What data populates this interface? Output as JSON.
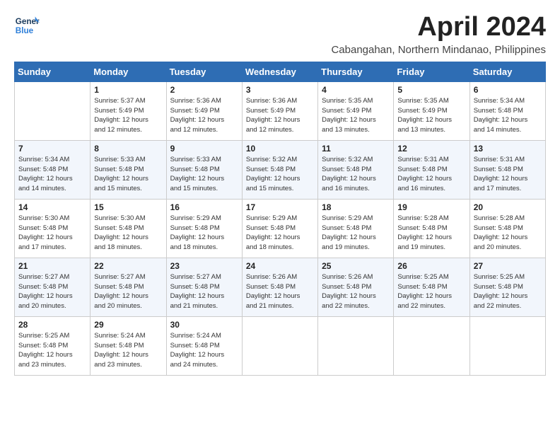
{
  "logo": {
    "line1": "General",
    "line2": "Blue"
  },
  "title": "April 2024",
  "subtitle": "Cabangahan, Northern Mindanao, Philippines",
  "days_of_week": [
    "Sunday",
    "Monday",
    "Tuesday",
    "Wednesday",
    "Thursday",
    "Friday",
    "Saturday"
  ],
  "weeks": [
    [
      {
        "day": "",
        "info": ""
      },
      {
        "day": "1",
        "info": "Sunrise: 5:37 AM\nSunset: 5:49 PM\nDaylight: 12 hours\nand 12 minutes."
      },
      {
        "day": "2",
        "info": "Sunrise: 5:36 AM\nSunset: 5:49 PM\nDaylight: 12 hours\nand 12 minutes."
      },
      {
        "day": "3",
        "info": "Sunrise: 5:36 AM\nSunset: 5:49 PM\nDaylight: 12 hours\nand 12 minutes."
      },
      {
        "day": "4",
        "info": "Sunrise: 5:35 AM\nSunset: 5:49 PM\nDaylight: 12 hours\nand 13 minutes."
      },
      {
        "day": "5",
        "info": "Sunrise: 5:35 AM\nSunset: 5:49 PM\nDaylight: 12 hours\nand 13 minutes."
      },
      {
        "day": "6",
        "info": "Sunrise: 5:34 AM\nSunset: 5:48 PM\nDaylight: 12 hours\nand 14 minutes."
      }
    ],
    [
      {
        "day": "7",
        "info": "Sunrise: 5:34 AM\nSunset: 5:48 PM\nDaylight: 12 hours\nand 14 minutes."
      },
      {
        "day": "8",
        "info": "Sunrise: 5:33 AM\nSunset: 5:48 PM\nDaylight: 12 hours\nand 15 minutes."
      },
      {
        "day": "9",
        "info": "Sunrise: 5:33 AM\nSunset: 5:48 PM\nDaylight: 12 hours\nand 15 minutes."
      },
      {
        "day": "10",
        "info": "Sunrise: 5:32 AM\nSunset: 5:48 PM\nDaylight: 12 hours\nand 15 minutes."
      },
      {
        "day": "11",
        "info": "Sunrise: 5:32 AM\nSunset: 5:48 PM\nDaylight: 12 hours\nand 16 minutes."
      },
      {
        "day": "12",
        "info": "Sunrise: 5:31 AM\nSunset: 5:48 PM\nDaylight: 12 hours\nand 16 minutes."
      },
      {
        "day": "13",
        "info": "Sunrise: 5:31 AM\nSunset: 5:48 PM\nDaylight: 12 hours\nand 17 minutes."
      }
    ],
    [
      {
        "day": "14",
        "info": "Sunrise: 5:30 AM\nSunset: 5:48 PM\nDaylight: 12 hours\nand 17 minutes."
      },
      {
        "day": "15",
        "info": "Sunrise: 5:30 AM\nSunset: 5:48 PM\nDaylight: 12 hours\nand 18 minutes."
      },
      {
        "day": "16",
        "info": "Sunrise: 5:29 AM\nSunset: 5:48 PM\nDaylight: 12 hours\nand 18 minutes."
      },
      {
        "day": "17",
        "info": "Sunrise: 5:29 AM\nSunset: 5:48 PM\nDaylight: 12 hours\nand 18 minutes."
      },
      {
        "day": "18",
        "info": "Sunrise: 5:29 AM\nSunset: 5:48 PM\nDaylight: 12 hours\nand 19 minutes."
      },
      {
        "day": "19",
        "info": "Sunrise: 5:28 AM\nSunset: 5:48 PM\nDaylight: 12 hours\nand 19 minutes."
      },
      {
        "day": "20",
        "info": "Sunrise: 5:28 AM\nSunset: 5:48 PM\nDaylight: 12 hours\nand 20 minutes."
      }
    ],
    [
      {
        "day": "21",
        "info": "Sunrise: 5:27 AM\nSunset: 5:48 PM\nDaylight: 12 hours\nand 20 minutes."
      },
      {
        "day": "22",
        "info": "Sunrise: 5:27 AM\nSunset: 5:48 PM\nDaylight: 12 hours\nand 20 minutes."
      },
      {
        "day": "23",
        "info": "Sunrise: 5:27 AM\nSunset: 5:48 PM\nDaylight: 12 hours\nand 21 minutes."
      },
      {
        "day": "24",
        "info": "Sunrise: 5:26 AM\nSunset: 5:48 PM\nDaylight: 12 hours\nand 21 minutes."
      },
      {
        "day": "25",
        "info": "Sunrise: 5:26 AM\nSunset: 5:48 PM\nDaylight: 12 hours\nand 22 minutes."
      },
      {
        "day": "26",
        "info": "Sunrise: 5:25 AM\nSunset: 5:48 PM\nDaylight: 12 hours\nand 22 minutes."
      },
      {
        "day": "27",
        "info": "Sunrise: 5:25 AM\nSunset: 5:48 PM\nDaylight: 12 hours\nand 22 minutes."
      }
    ],
    [
      {
        "day": "28",
        "info": "Sunrise: 5:25 AM\nSunset: 5:48 PM\nDaylight: 12 hours\nand 23 minutes."
      },
      {
        "day": "29",
        "info": "Sunrise: 5:24 AM\nSunset: 5:48 PM\nDaylight: 12 hours\nand 23 minutes."
      },
      {
        "day": "30",
        "info": "Sunrise: 5:24 AM\nSunset: 5:48 PM\nDaylight: 12 hours\nand 24 minutes."
      },
      {
        "day": "",
        "info": ""
      },
      {
        "day": "",
        "info": ""
      },
      {
        "day": "",
        "info": ""
      },
      {
        "day": "",
        "info": ""
      }
    ]
  ]
}
